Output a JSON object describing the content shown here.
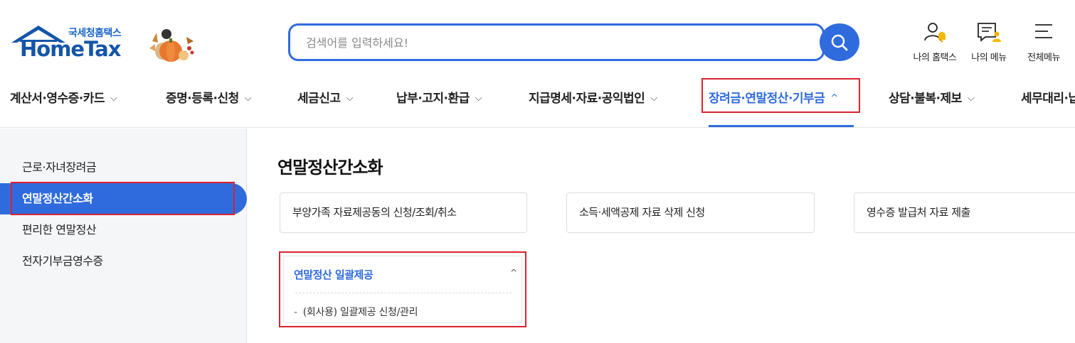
{
  "header": {
    "logo_sub": "국세청홈택스",
    "logo_main": "HomeTax",
    "search_placeholder": "검색어를 입력하세요!",
    "utils": [
      {
        "label": "나의 홈택스",
        "icon": "user-bell-icon"
      },
      {
        "label": "나의 메뉴",
        "icon": "menu-user-icon"
      },
      {
        "label": "전체메뉴",
        "icon": "hamburger-icon"
      }
    ]
  },
  "gnb": {
    "items": [
      {
        "label": "계산서·영수증·카드",
        "chevron": "⌵"
      },
      {
        "label": "증명·등록·신청",
        "chevron": "⌵"
      },
      {
        "label": "세금신고",
        "chevron": "⌵"
      },
      {
        "label": "납부·고지·환급",
        "chevron": "⌵"
      },
      {
        "label": "지급명세·자료·공익법인",
        "chevron": "⌵"
      },
      {
        "label": "장려금·연말정산·기부금",
        "chevron": "^"
      },
      {
        "label": "상담·불복·제보",
        "chevron": "⌵"
      },
      {
        "label": "세무대리·납"
      }
    ],
    "active_index": 5
  },
  "sidebar": {
    "items": [
      {
        "label": "근로·자녀장려금"
      },
      {
        "label": "연말정산간소화"
      },
      {
        "label": "편리한 연말정산"
      },
      {
        "label": "전자기부금영수증"
      }
    ],
    "active_index": 1
  },
  "main": {
    "title": "연말정산간소화",
    "cards": [
      {
        "label": "부양가족 자료제공동의 신청/조회/취소"
      },
      {
        "label": "소득·세액공제 자료 삭제 신청"
      },
      {
        "label": "영수증 발급처 자료 제출"
      }
    ],
    "accordion": {
      "title": "연말정산 일괄제공",
      "chevron": "^",
      "bullet": "-",
      "subitem": "(회사용) 일괄제공 신청/관리"
    }
  },
  "colors": {
    "accent": "#2f6bdd",
    "highlight_border": "#d9232e",
    "logo_blue": "#1455a8"
  }
}
